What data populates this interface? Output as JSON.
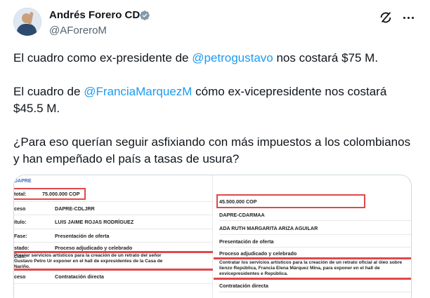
{
  "author": {
    "name": "Andrés Forero CD",
    "handle": "@AForeroM"
  },
  "post": {
    "p1_before": "El cuadro como ex-presidente de ",
    "p1_mention": "@petrogustavo",
    "p1_after": " nos costará $75 M.",
    "p2_before": "El cuadro de ",
    "p2_mention": "@FranciaMarquezM",
    "p2_after": " cómo ex-vicepresidente nos costará $45.5 M.",
    "p3": "¿Para eso querían seguir asfixiando con más impuestos a los colombianos y han empeñado el país a tasas de usura?"
  },
  "media": {
    "left": {
      "header": "DAPRE",
      "rows": [
        {
          "label": "total:",
          "value": "75.000.000 COP"
        },
        {
          "label": "ceso",
          "value": "DAPRE-CDLJRR"
        },
        {
          "label": "ítulo:",
          "value": "LUIS JAIME ROJAS RODRÍGUEZ"
        },
        {
          "label": "Fase:",
          "value": "Presentación de oferta"
        },
        {
          "label": "stado:",
          "value": "Proceso adjudicado y celebrado"
        },
        {
          "label": "ción:",
          "value": "Prestar servicios artísticos para la creación de un retrato del señor Gustavo Petro Ur exponer en el hall de expresidentes de la Casa de Nariño."
        },
        {
          "label": "ceso",
          "value": "Contratación directa"
        }
      ]
    },
    "right": {
      "rows": [
        {
          "value": "45.500.000 COP"
        },
        {
          "value": "DAPRE-CDARMAA"
        },
        {
          "value": "ADA RUTH MARGARITA ARIZA AGUILAR"
        },
        {
          "value": "Presentación de oferta"
        },
        {
          "value": "Proceso adjudicado y celebrado"
        },
        {
          "value": "Contratar los servicios artísticos para la creación de un retrato oficial al óleo sobre lienzo República, Francia Elena Márquez Mina, para exponer en el hall de exvicepresidentes e República."
        },
        {
          "value": "Contratación directa"
        }
      ]
    }
  },
  "colors": {
    "mention": "#1d9bf0",
    "highlight": "#e0484a",
    "verified": "#829aab"
  },
  "icons": [
    "verified-badge-icon",
    "grok-icon",
    "more-options-icon"
  ]
}
